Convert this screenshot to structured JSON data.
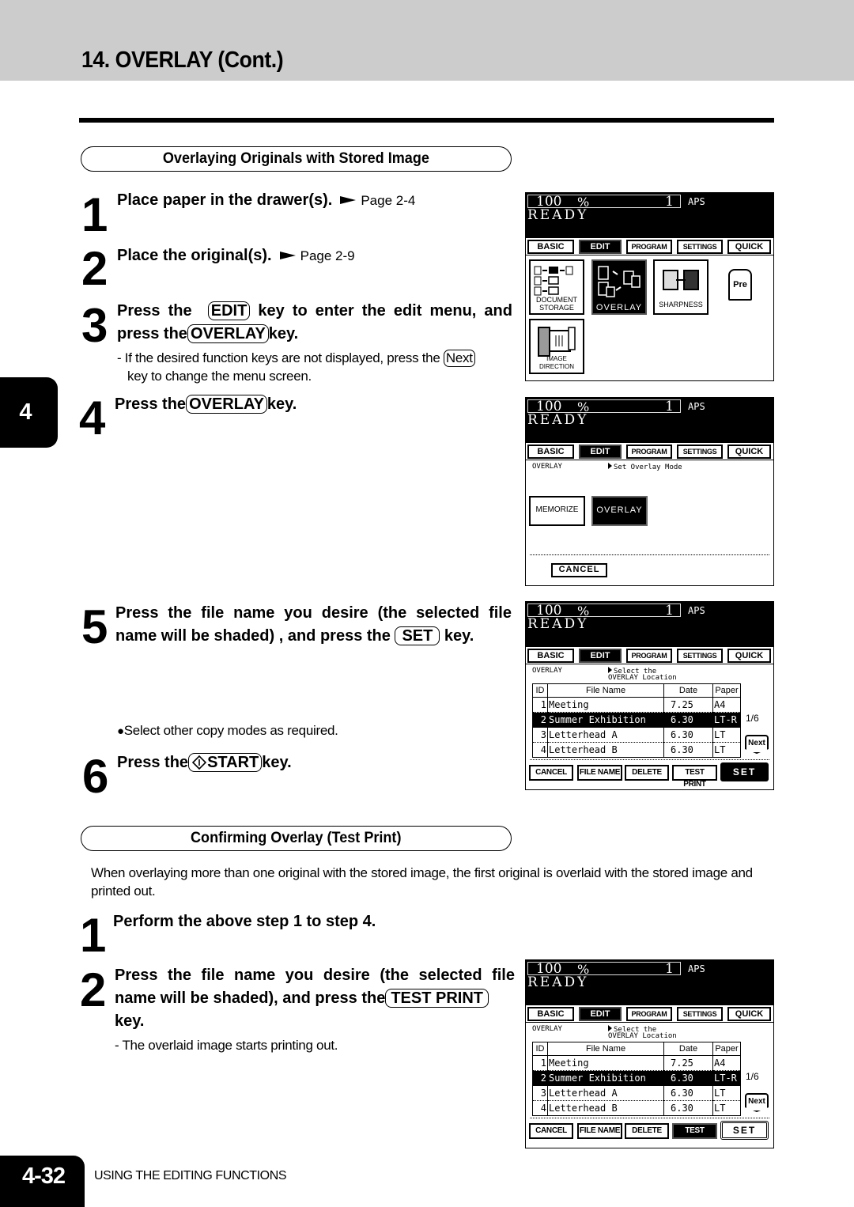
{
  "page": {
    "title": "14. OVERLAY (Cont.)",
    "chapter_tab": "4",
    "page_number": "4-32",
    "footer_text": "USING THE EDITING FUNCTIONS"
  },
  "section1": {
    "heading": "Overlaying Originals with Stored Image",
    "steps": [
      {
        "num": "1",
        "text": "Place paper in the drawer(s).",
        "ref": "Page 2-4"
      },
      {
        "num": "2",
        "text": "Place the original(s).",
        "ref": "Page 2-9"
      },
      {
        "num": "3",
        "pre": "Press the",
        "key1": "EDIT",
        "mid": "key to enter the edit menu, and",
        "pre2": "press the",
        "key2": "OVERLAY",
        "post": "key.",
        "note_pre": "- If the desired function keys are not displayed, press the",
        "note_key": "Next",
        "note_post": "key to change the menu screen."
      },
      {
        "num": "4",
        "pre": "Press the",
        "key": "OVERLAY",
        "post": "key."
      },
      {
        "num": "5",
        "line1": "Press the file name you desire (the selected file",
        "pre": "name will be shaded) , and press the",
        "key": "SET",
        "post": "key.",
        "bullet": "Select other copy modes as required."
      },
      {
        "num": "6",
        "pre": "Press the",
        "key": "START",
        "post": "key."
      }
    ]
  },
  "section2": {
    "heading": "Confirming Overlay (Test Print)",
    "intro": "When overlaying more than one original with the stored image, the first original is overlaid with the stored image and printed out.",
    "steps": [
      {
        "num": "1",
        "text": "Perform the above step 1 to step 4."
      },
      {
        "num": "2",
        "line1": "Press the file name you desire (the selected file",
        "pre": "name will be shaded), and press the",
        "key": "TEST PRINT",
        "post": "key.",
        "note": "- The overlaid image starts printing  out."
      }
    ]
  },
  "lcd": {
    "zoom": "100",
    "percent": "%",
    "copies": "1",
    "aps": "APS",
    "status": "READY",
    "tabs": [
      "BASIC",
      "EDIT",
      "PROGRAM",
      "SETTINGS",
      "QUICK"
    ],
    "active_tab": "EDIT",
    "edit_menu": {
      "buttons": [
        "DOCUMENT STORAGE",
        "OVERLAY",
        "SHARPNESS",
        "Pre",
        "IMAGE DIRECTION"
      ],
      "doc_storage_line1": "DOCUMENT",
      "doc_storage_line2": "STORAGE",
      "selected": "OVERLAY"
    },
    "overlay_mode": {
      "crumb": "OVERLAY",
      "hint": "Set Overlay Mode",
      "buttons": [
        "MEMORIZE",
        "OVERLAY"
      ],
      "selected": "OVERLAY",
      "cancel": "CANCEL"
    },
    "file_select": {
      "crumb": "OVERLAY",
      "hint_line1": "Select the",
      "hint_line2": "OVERLAY Location",
      "columns": [
        "ID",
        "File Name",
        "Date",
        "Paper"
      ],
      "rows": [
        {
          "id": "1",
          "name": "Meeting",
          "date": "7.25",
          "paper": "A4"
        },
        {
          "id": "2",
          "name": "Summer Exhibition",
          "date": "6.30",
          "paper": "LT-R"
        },
        {
          "id": "3",
          "name": "Letterhead A",
          "date": "6.30",
          "paper": "LT"
        },
        {
          "id": "4",
          "name": "Letterhead B",
          "date": "6.30",
          "paper": "LT"
        }
      ],
      "selected_id": "2",
      "pager": "1/6",
      "next": "Next",
      "buttons": [
        "CANCEL",
        "FILE NAME",
        "DELETE",
        "TEST PRINT",
        "SET"
      ]
    }
  }
}
